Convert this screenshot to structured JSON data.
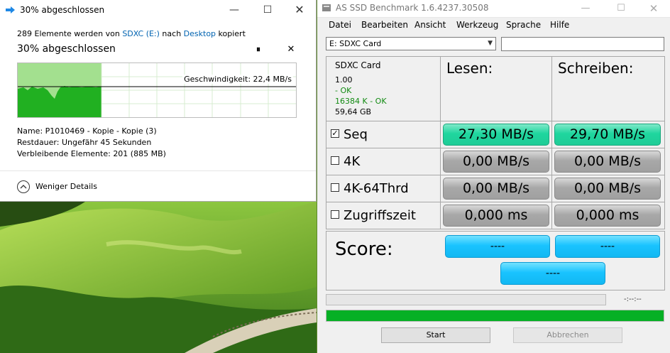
{
  "copy_dialog": {
    "title": "30% abgeschlossen",
    "line_prefix": "289 Elemente werden von ",
    "source": "SDXC (E:)",
    "line_mid": " nach ",
    "destination": "Desktop",
    "line_suffix": " kopiert",
    "progress_text": "30% abgeschlossen",
    "progress": 0.3,
    "speed": "Geschwindigkeit: 22,4 MB/s",
    "name_label": "Name:",
    "name_value": "P1010469 - Kopie - Kopie (3)",
    "remaining_label": "Restdauer:",
    "remaining_value": "Ungefähr 45 Sekunden",
    "items_label": "Verbleibende Elemente:",
    "items_value": "201 (885 MB)",
    "less_details": "Weniger Details",
    "min_glyph": "—",
    "max_glyph": "☐",
    "close_glyph": "✕",
    "pause_glyph": "⏸",
    "cancel_glyph": "✕",
    "icons": {
      "title": "copy-icon",
      "less": "chevron-up-icon"
    },
    "colors": {
      "graph_fill": "#21b021",
      "graph_light": "#a3e08f",
      "link": "#0063b1"
    }
  },
  "ssd": {
    "title": "AS SSD Benchmark 1.6.4237.30508",
    "min_glyph": "—",
    "max_glyph": "☐",
    "close_glyph": "✕",
    "menu": [
      "Datei",
      "Bearbeiten",
      "Ansicht",
      "Werkzeug",
      "Sprache",
      "Hilfe"
    ],
    "drive_selected": "E: SDXC Card",
    "drive_info": {
      "name": "SDXC Card",
      "version": "1.00",
      "status1": " - OK",
      "status2": "16384 K - OK",
      "size": "59,64 GB"
    },
    "read_header": "Lesen:",
    "write_header": "Schreiben:",
    "rows": [
      {
        "label": "Seq",
        "checked": true,
        "read": "27,30 MB/s",
        "write": "29,70 MB/s",
        "state": "done"
      },
      {
        "label": "4K",
        "checked": false,
        "read": "0,00 MB/s",
        "write": "0,00 MB/s",
        "state": "idle"
      },
      {
        "label": "4K-64Thrd",
        "checked": false,
        "read": "0,00 MB/s",
        "write": "0,00 MB/s",
        "state": "idle"
      },
      {
        "label": "Zugriffszeit",
        "checked": false,
        "read": "0,000 ms",
        "write": "0,000 ms",
        "state": "idle"
      }
    ],
    "check_glyph": "✓",
    "score_label": "Score:",
    "score_read": "----",
    "score_write": "----",
    "score_total": "----",
    "time_label": "-:--:--",
    "progress": 1.0,
    "start_button": "Start",
    "abort_button": "Abbrechen",
    "colors": {
      "seq_done": "#1fd69e",
      "idle": "#a8a8a8",
      "score": "#19c3ff",
      "progress": "#06b025"
    }
  }
}
